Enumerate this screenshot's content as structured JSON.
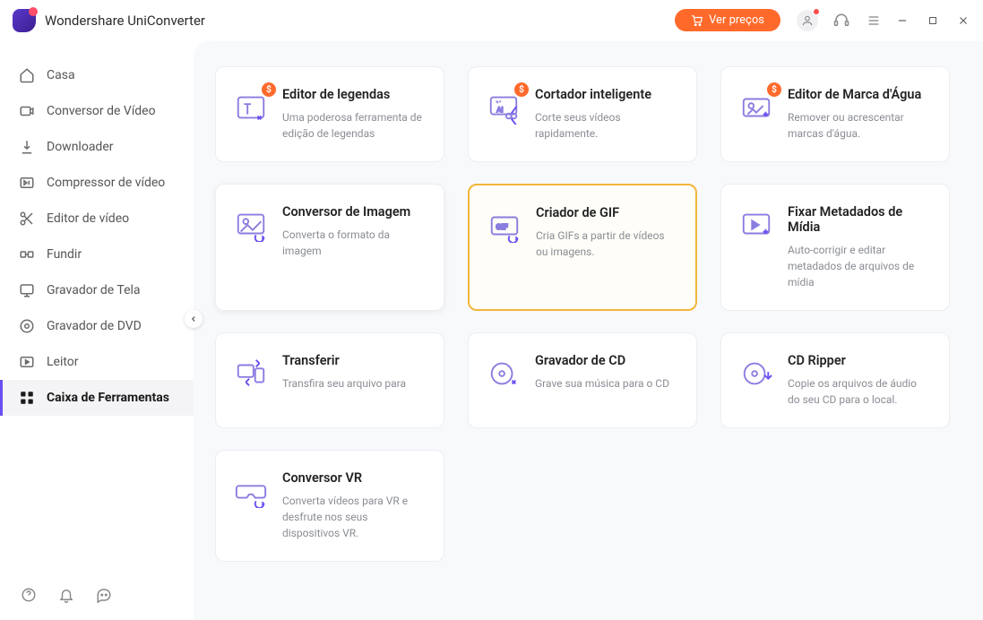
{
  "app": {
    "title": "Wondershare UniConverter"
  },
  "header": {
    "price_button": "Ver preços"
  },
  "sidebar": {
    "items": [
      {
        "label": "Casa"
      },
      {
        "label": "Conversor de Vídeo"
      },
      {
        "label": "Downloader"
      },
      {
        "label": "Compressor de vídeo"
      },
      {
        "label": "Editor de vídeo"
      },
      {
        "label": "Fundir"
      },
      {
        "label": "Gravador de Tela"
      },
      {
        "label": "Gravador de DVD"
      },
      {
        "label": "Leitor"
      },
      {
        "label": "Caixa de Ferramentas"
      }
    ]
  },
  "tools": [
    {
      "title": "Editor de legendas",
      "desc": "Uma poderosa ferramenta de edição de legendas",
      "badge": "$"
    },
    {
      "title": "Cortador inteligente",
      "desc": "Corte seus vídeos rapidamente.",
      "badge": "$"
    },
    {
      "title": "Editor de Marca d'Água",
      "desc": "Remover ou acrescentar marcas d'água.",
      "badge": "$"
    },
    {
      "title": "Conversor de Imagem",
      "desc": "Converta o formato da imagem"
    },
    {
      "title": "Criador de GIF",
      "desc": "Cria GIFs a partir de vídeos ou imagens."
    },
    {
      "title": "Fixar Metadados de Mídia",
      "desc": "Auto-corrigir e editar metadados de arquivos de mídia"
    },
    {
      "title": "Transferir",
      "desc": "Transfira seu arquivo para"
    },
    {
      "title": "Gravador de CD",
      "desc": "Grave sua música para o CD"
    },
    {
      "title": "CD Ripper",
      "desc": "Copie os arquivos de áudio do seu CD para o local."
    },
    {
      "title": "Conversor VR",
      "desc": "Converta vídeos para VR e desfrute nos seus dispositivos VR."
    }
  ]
}
